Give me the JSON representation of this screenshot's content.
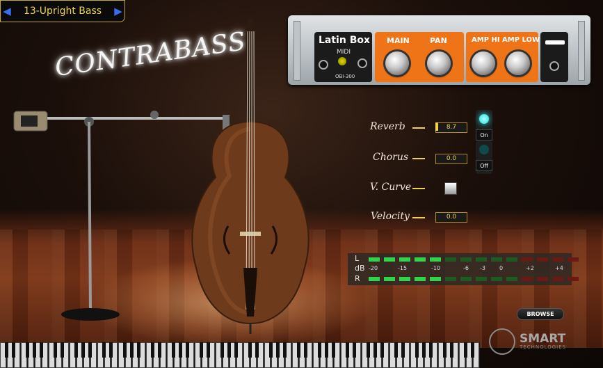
{
  "preset": {
    "prev_icon": "◀",
    "next_icon": "▶",
    "name": "13-Upright Bass"
  },
  "title": "CONTRABASS",
  "amp": {
    "brand": "Latin Box",
    "midi_label": "MIDI",
    "model": "OBI-300",
    "labels": {
      "main": "MAIN",
      "pan": "PAN",
      "amp_hi": "AMP HI",
      "amp_low": "AMP LOW"
    }
  },
  "controls": [
    {
      "label": "Reverb",
      "value": "8.7"
    },
    {
      "label": "Chorus",
      "value": "0.0"
    },
    {
      "label": "V. Curve"
    },
    {
      "label": "Velocity",
      "value": "0.0"
    }
  ],
  "switch": {
    "on_label": "On",
    "off_label": "Off"
  },
  "meter": {
    "left_label": "L",
    "right_label": "R",
    "db_label": "dB",
    "scale": [
      "-20",
      "-15",
      "-10",
      "-6",
      "-3",
      "0",
      "+2",
      "+4"
    ],
    "left_lit": 5,
    "right_lit": 5,
    "segments": 14
  },
  "browse_label": "BROWSE",
  "logo": {
    "name": "SMART",
    "sub": "TECHNOLOGIES"
  },
  "colors": {
    "accent": "#f2d24a",
    "amp_orange": "#ef7418",
    "led_green": "#34d24a",
    "led_dim": "#1f5a22",
    "led_red_dim": "#6a1a14",
    "lamp_on": "#27e0e0",
    "lamp_off": "#0f4a4a"
  }
}
